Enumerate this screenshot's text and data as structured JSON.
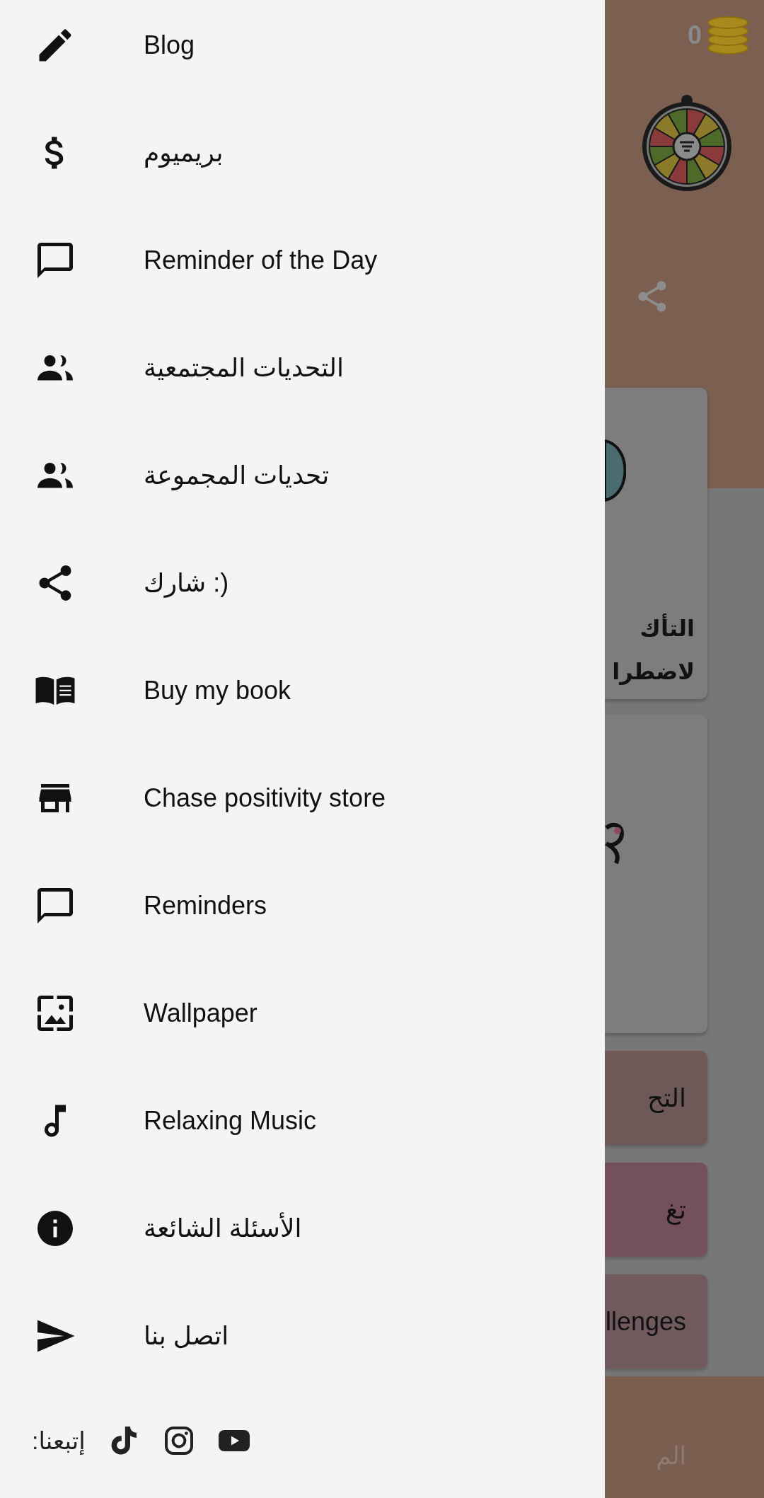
{
  "drawer": {
    "items": [
      {
        "label": "Blog"
      },
      {
        "label": "بريميوم"
      },
      {
        "label": "Reminder of the Day"
      },
      {
        "label": "التحديات المجتمعية"
      },
      {
        "label": "تحديات المجموعة"
      },
      {
        "label": "شارك :)"
      },
      {
        "label": "Buy my book"
      },
      {
        "label": "Chase positivity store"
      },
      {
        "label": "Reminders"
      },
      {
        "label": "Wallpaper"
      },
      {
        "label": "Relaxing Music"
      },
      {
        "label": "الأسئلة الشائعة"
      },
      {
        "label": "اتصل بنا"
      }
    ],
    "footer": {
      "label": "إتبعنا:"
    }
  },
  "background": {
    "coins": "0",
    "cards": [
      {
        "kind": "illustration",
        "lines": [
          "التأك",
          "لاضطرا"
        ]
      },
      {
        "kind": "illustration"
      }
    ],
    "buttons": [
      {
        "label": "التح",
        "color": "#6f5858"
      },
      {
        "label": "تغ",
        "color": "#74505f"
      },
      {
        "label": "llenges",
        "color": "#705a5e"
      }
    ],
    "bottom_bar": {
      "label": "الم"
    }
  }
}
